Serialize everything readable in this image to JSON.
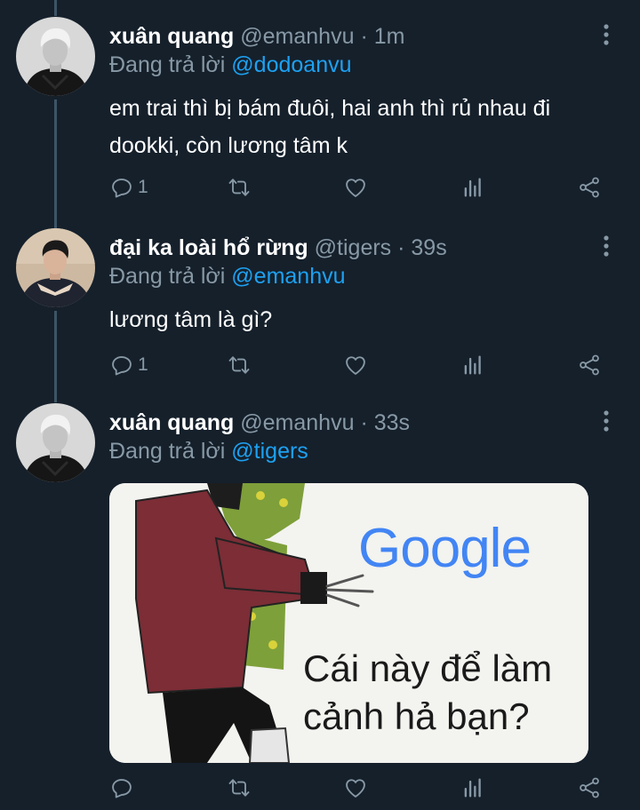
{
  "tweets": [
    {
      "name": "xuân quang",
      "handle": "@emanhvu",
      "separator": "·",
      "time": "1m",
      "reply_prefix": "Đang trả lời",
      "reply_to": "@dodoanvu",
      "text": "em trai thì bị bám đuôi, hai anh thì rủ nhau đi dookki, còn lương tâm k",
      "reply_count": "1"
    },
    {
      "name": "đại ka loài hổ rừng",
      "handle": "@tigers",
      "separator": "·",
      "time": "39s",
      "reply_prefix": "Đang trả lời",
      "reply_to": "@emanhvu",
      "text": "lương tâm là gì?",
      "reply_count": "1"
    },
    {
      "name": "xuân quang",
      "handle": "@emanhvu",
      "separator": "·",
      "time": "33s",
      "reply_prefix": "Đang trả lời",
      "reply_to": "@tigers",
      "reply_count": "",
      "media": {
        "google_text": "Google",
        "caption_line1": "Cái này để làm",
        "caption_line2": "cảnh hả bạn?"
      }
    }
  ],
  "colors": {
    "background": "#15202b",
    "secondary_text": "#8899a6",
    "mention": "#1da1f2",
    "thread_line": "#3d5466"
  },
  "icons": [
    "reply-icon",
    "retweet-icon",
    "like-icon",
    "analytics-icon",
    "share-icon",
    "more-options-icon"
  ]
}
